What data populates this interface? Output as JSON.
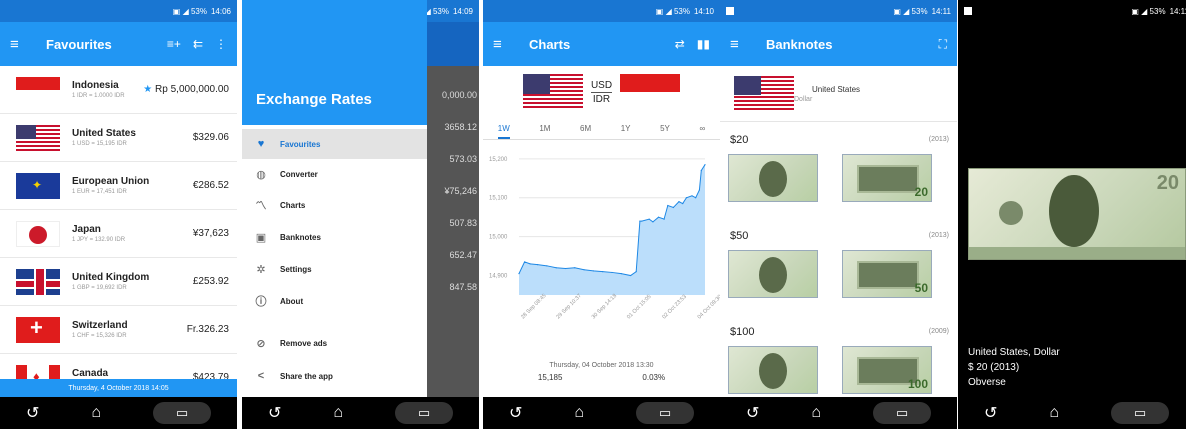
{
  "screen1": {
    "status_time": "14:06",
    "title": "Favourites",
    "rows": [
      {
        "name": "Indonesia",
        "rate": "1 IDR = 1.0000 IDR",
        "value": "Rp 5,000,000.00",
        "starred": true,
        "flag": "f-id"
      },
      {
        "name": "United States",
        "rate": "1 USD = 15,195 IDR",
        "value": "$329.06",
        "starred": false,
        "flag": "f-us"
      },
      {
        "name": "European Union",
        "rate": "1 EUR = 17,451 IDR",
        "value": "€286.52",
        "starred": false,
        "flag": "f-eu"
      },
      {
        "name": "Japan",
        "rate": "1 JPY = 132.90 IDR",
        "value": "¥37,623",
        "starred": false,
        "flag": "f-jp"
      },
      {
        "name": "United Kingdom",
        "rate": "1 GBP = 19,692 IDR",
        "value": "£253.92",
        "starred": false,
        "flag": "f-uk"
      },
      {
        "name": "Switzerland",
        "rate": "1 CHF = 15,326 IDR",
        "value": "Fr.326.23",
        "starred": false,
        "flag": "f-ch"
      },
      {
        "name": "Canada",
        "rate": "1 CAD = 11,757 IDR",
        "value": "$423.79",
        "starred": false,
        "flag": "f-ca"
      }
    ],
    "footer": "Thursday, 4 October 2018 14:05"
  },
  "screen2": {
    "status_time": "14:09",
    "header": "Exchange Rates",
    "items": [
      {
        "label": "Favourites",
        "icon": "♥",
        "selected": true
      },
      {
        "label": "Converter",
        "icon": "◍",
        "selected": false
      },
      {
        "label": "Charts",
        "icon": "〽",
        "selected": false
      },
      {
        "label": "Banknotes",
        "icon": "▣",
        "selected": false
      },
      {
        "label": "Settings",
        "icon": "✲",
        "selected": false
      },
      {
        "label": "About",
        "icon": "ⓘ",
        "selected": false
      },
      {
        "label": "Remove ads",
        "icon": "⊘",
        "selected": false
      },
      {
        "label": "Share the app",
        "icon": "<",
        "selected": false
      }
    ],
    "behind_values": [
      "0,000.00",
      "3658.12",
      "573.03",
      "¥75,246",
      "507.83",
      "652.47",
      "847.58"
    ]
  },
  "screen3": {
    "status_time": "14:10",
    "title": "Charts",
    "pair_from": "USD",
    "pair_to": "IDR",
    "ranges": [
      "1W",
      "1M",
      "6M",
      "1Y",
      "5Y",
      "∞"
    ],
    "active_range": "1W",
    "footer_date": "Thursday, 04 October 2018 13:30",
    "footer_value": "15,185",
    "footer_change": "0.03%"
  },
  "chart_data": {
    "type": "area",
    "title": "",
    "xlabel": "",
    "ylabel": "",
    "x_ticks": [
      "28 Sep 08:45",
      "29 Sep 10:37",
      "30 Sep 14:18",
      "01 Oct 15:05",
      "02 Oct 23:53",
      "04 Oct 09:30"
    ],
    "y_ticks": [
      14900,
      15000,
      15100,
      15200
    ],
    "ylim": [
      14850,
      15215
    ],
    "x": [
      0,
      0.03,
      0.06,
      0.1,
      0.15,
      0.2,
      0.25,
      0.3,
      0.35,
      0.4,
      0.45,
      0.5,
      0.55,
      0.6,
      0.63,
      0.65,
      0.66,
      0.7,
      0.72,
      0.75,
      0.78,
      0.8,
      0.83,
      0.86,
      0.88,
      0.9,
      0.93,
      0.95,
      0.97,
      0.98,
      1.0
    ],
    "values": [
      14905,
      14935,
      14930,
      14928,
      14925,
      14920,
      14918,
      14920,
      14915,
      14912,
      14910,
      14908,
      14905,
      14900,
      14910,
      15040,
      15040,
      15045,
      15038,
      15050,
      15045,
      15080,
      15075,
      15090,
      15085,
      15100,
      15105,
      15100,
      15120,
      15170,
      15185
    ]
  },
  "screen4": {
    "status_time": "14:11",
    "title": "Banknotes",
    "country": "United States",
    "currency": "Dollar",
    "notes": [
      {
        "denom": "$20",
        "year": "(2013)",
        "num": "20"
      },
      {
        "denom": "$50",
        "year": "(2013)",
        "num": "50"
      },
      {
        "denom": "$100",
        "year": "(2009)",
        "num": "100"
      }
    ]
  },
  "screen5": {
    "status_time": "14:11",
    "line1": "United States, Dollar",
    "line2": "$ 20 (2013)",
    "line3": "Obverse",
    "note_num": "20"
  }
}
